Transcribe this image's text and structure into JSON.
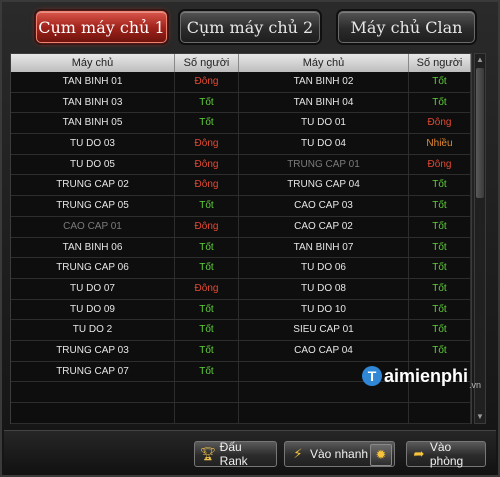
{
  "tabs": [
    {
      "label": "Cụm máy chủ 1",
      "active": true
    },
    {
      "label": "Cụm máy chủ 2",
      "active": false
    },
    {
      "label": "Máy chủ Clan",
      "active": false
    }
  ],
  "table": {
    "headers": [
      "Máy chủ",
      "Số người",
      "Máy chủ",
      "Số người"
    ],
    "rows": [
      {
        "left_server": "TAN BINH 01",
        "left_status": "Đông",
        "right_server": "TAN BINH 02",
        "right_status": "Tốt"
      },
      {
        "left_server": "TAN BINH 03",
        "left_status": "Tốt",
        "right_server": "TAN BINH 04",
        "right_status": "Tốt"
      },
      {
        "left_server": "TAN BINH 05",
        "left_status": "Tốt",
        "right_server": "TU DO 01",
        "right_status": "Đông"
      },
      {
        "left_server": "TU DO 03",
        "left_status": "Đông",
        "right_server": "TU DO 04",
        "right_status": "Nhiều"
      },
      {
        "left_server": "TU DO 05",
        "left_status": "Đông",
        "right_server": "TRUNG CAP 01",
        "right_status": "Đông"
      },
      {
        "left_server": "TRUNG CAP 02",
        "left_status": "Đông",
        "right_server": "TRUNG CAP 04",
        "right_status": "Tốt"
      },
      {
        "left_server": "TRUNG CAP 05",
        "left_status": "Tốt",
        "right_server": "CAO CAP 03",
        "right_status": "Tốt"
      },
      {
        "left_server": "CAO CAP 01",
        "left_status": "Đông",
        "right_server": "CAO CAP 02",
        "right_status": "Tốt"
      },
      {
        "left_server": "TAN BINH 06",
        "left_status": "Tốt",
        "right_server": "TAN BINH 07",
        "right_status": "Tốt"
      },
      {
        "left_server": "TRUNG CAP 06",
        "left_status": "Tốt",
        "right_server": "TU DO 06",
        "right_status": "Tốt"
      },
      {
        "left_server": "TU DO 07",
        "left_status": "Đông",
        "right_server": "TU DO 08",
        "right_status": "Tốt"
      },
      {
        "left_server": "TU DO 09",
        "left_status": "Tốt",
        "right_server": "TU DO 10",
        "right_status": "Tốt"
      },
      {
        "left_server": "TU DO 2",
        "left_status": "Tốt",
        "right_server": "SIEU CAP 01",
        "right_status": "Tốt"
      },
      {
        "left_server": "TRUNG CAP 03",
        "left_status": "Tốt",
        "right_server": "CAO CAP 04",
        "right_status": "Tốt"
      },
      {
        "left_server": "TRUNG CAP 07",
        "left_status": "Tốt",
        "right_server": "",
        "right_status": ""
      },
      {
        "left_server": "",
        "left_status": "",
        "right_server": "",
        "right_status": ""
      },
      {
        "left_server": "",
        "left_status": "",
        "right_server": "",
        "right_status": ""
      }
    ],
    "dimmed_servers": [
      "CAO CAP 01",
      "TRUNG CAP 01"
    ]
  },
  "status_colors": {
    "Tốt": "#5fcf3a",
    "Đông": "#e24a34",
    "Nhiều": "#e28a34"
  },
  "buttons": {
    "rank": {
      "label": "Đấu Rank",
      "icon": "trophy-icon"
    },
    "quick": {
      "label": "Vào nhanh",
      "icon": "lightning-icon",
      "extra_icon": "gear-icon"
    },
    "room": {
      "label": "Vào phòng",
      "icon": "arrow-right-icon"
    }
  },
  "watermark": {
    "text": "aimienphi",
    "suffix": ".vn",
    "logo_letter": "T"
  }
}
